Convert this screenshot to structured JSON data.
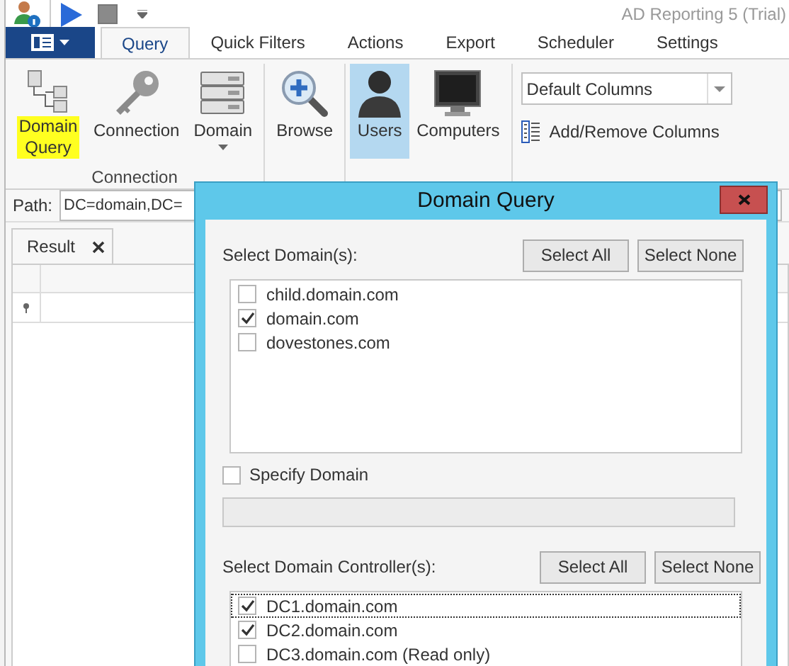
{
  "window": {
    "title": "AD Reporting 5 (Trial)"
  },
  "ribbon_tabs": [
    {
      "label": "Query",
      "selected": true
    },
    {
      "label": "Quick Filters",
      "selected": false
    },
    {
      "label": "Actions",
      "selected": false
    },
    {
      "label": "Export",
      "selected": false
    },
    {
      "label": "Scheduler",
      "selected": false
    },
    {
      "label": "Settings",
      "selected": false
    }
  ],
  "ribbon": {
    "groups": [
      {
        "label": "Connection",
        "buttons": [
          {
            "kind": "tree",
            "label": "Domain Query",
            "highlighted": true,
            "selected": false,
            "dropdown": false
          },
          {
            "kind": "key",
            "label": "Connection",
            "highlighted": false,
            "selected": false,
            "dropdown": false
          },
          {
            "kind": "server",
            "label": "Domain",
            "highlighted": false,
            "selected": false,
            "dropdown": true
          }
        ]
      },
      {
        "buttons": [
          {
            "kind": "search",
            "label": "Browse",
            "highlighted": false,
            "selected": false,
            "dropdown": false
          }
        ]
      },
      {
        "buttons": [
          {
            "kind": "user",
            "label": "Users",
            "highlighted": false,
            "selected": true,
            "dropdown": false
          },
          {
            "kind": "monitor",
            "label": "Computers",
            "highlighted": false,
            "selected": false,
            "dropdown": false
          }
        ]
      }
    ],
    "columns_select": {
      "value": "Default Columns"
    },
    "add_remove": "Add/Remove Columns"
  },
  "path": {
    "label": "Path:",
    "value": "DC=domain,DC="
  },
  "result_tab": {
    "label": "Result"
  },
  "dialog": {
    "title": "Domain Query",
    "domains": {
      "label": "Select Domain(s):",
      "buttons": [
        "Select All",
        "Select None"
      ],
      "items": [
        {
          "label": "child.domain.com",
          "checked": false,
          "focused": false
        },
        {
          "label": "domain.com",
          "checked": true,
          "focused": false
        },
        {
          "label": "dovestones.com",
          "checked": false,
          "focused": false
        }
      ]
    },
    "specify_domain": {
      "label": "Specify Domain",
      "checked": false
    },
    "controllers": {
      "label": "Select Domain Controller(s):",
      "buttons": [
        "Select All",
        "Select None"
      ],
      "items": [
        {
          "label": "DC1.domain.com",
          "checked": true,
          "focused": true
        },
        {
          "label": "DC2.domain.com",
          "checked": true,
          "focused": false
        },
        {
          "label": "DC3.domain.com (Read only)",
          "checked": false,
          "focused": false
        }
      ]
    }
  }
}
